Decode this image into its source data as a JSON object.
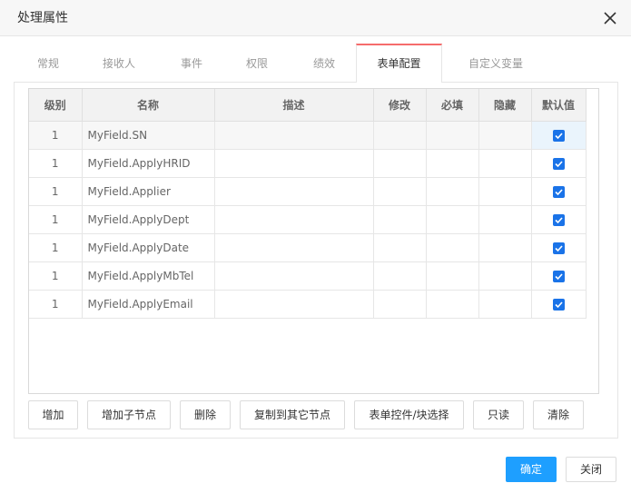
{
  "dialog": {
    "title": "处理属性",
    "close_icon": "close-icon"
  },
  "tabs": [
    {
      "label": "常规"
    },
    {
      "label": "接收人"
    },
    {
      "label": "事件"
    },
    {
      "label": "权限"
    },
    {
      "label": "绩效"
    },
    {
      "label": "表单配置",
      "active": true
    },
    {
      "label": "自定义变量"
    }
  ],
  "table": {
    "columns": [
      "级别",
      "名称",
      "描述",
      "修改",
      "必填",
      "隐藏",
      "默认值"
    ],
    "rows": [
      {
        "level": "1",
        "name": "MyField.SN",
        "default_checked": true
      },
      {
        "level": "1",
        "name": "MyField.ApplyHRID",
        "default_checked": true
      },
      {
        "level": "1",
        "name": "MyField.Applier",
        "default_checked": true
      },
      {
        "level": "1",
        "name": "MyField.ApplyDept",
        "default_checked": true
      },
      {
        "level": "1",
        "name": "MyField.ApplyDate",
        "default_checked": true
      },
      {
        "level": "1",
        "name": "MyField.ApplyMbTel",
        "default_checked": true
      },
      {
        "level": "1",
        "name": "MyField.ApplyEmail",
        "default_checked": true
      }
    ]
  },
  "toolbar": {
    "add": "增加",
    "add_child": "增加子节点",
    "delete": "删除",
    "copy_to_other": "复制到其它节点",
    "form_control_select": "表单控件/块选择",
    "readonly": "只读",
    "clear": "清除"
  },
  "footer": {
    "ok": "确定",
    "close": "关闭"
  },
  "colors": {
    "primary": "#1e9fff",
    "tab_active_border": "#f56c6c",
    "checkbox": "#1a73e8"
  }
}
